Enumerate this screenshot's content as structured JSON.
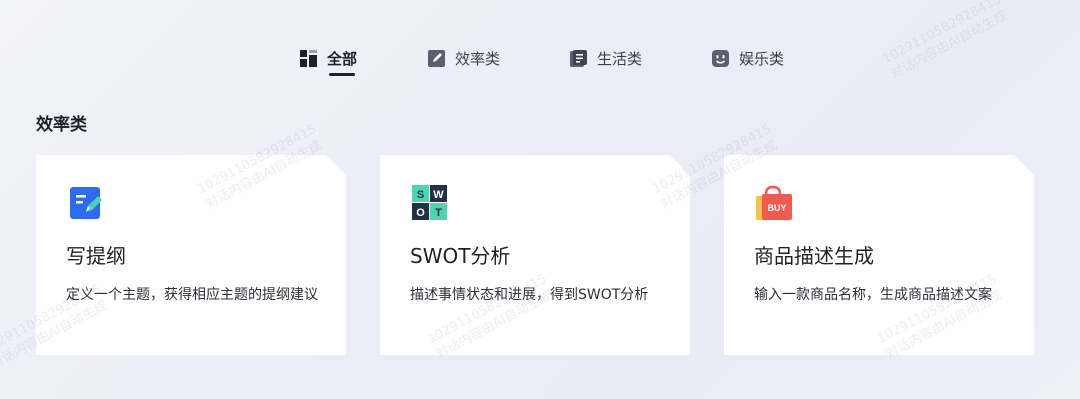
{
  "tabs": [
    {
      "label": "全部",
      "icon": "grid-icon",
      "active": true
    },
    {
      "label": "效率类",
      "icon": "edit-doc-icon",
      "active": false
    },
    {
      "label": "生活类",
      "icon": "notes-icon",
      "active": false
    },
    {
      "label": "娱乐类",
      "icon": "smiley-icon",
      "active": false
    }
  ],
  "section": {
    "title": "效率类"
  },
  "cards": [
    {
      "title": "写提纲",
      "description": "定义一个主题，获得相应主题的提纲建议",
      "icon": "outline-doc-icon"
    },
    {
      "title": "SWOT分析",
      "description": "描述事情状态和进展，得到SWOT分析",
      "icon": "swot-icon",
      "icon_letters": [
        "S",
        "W",
        "O",
        "T"
      ]
    },
    {
      "title": "商品描述生成",
      "description": "输入一款商品名称，生成商品描述文案",
      "icon": "shopping-bag-icon",
      "icon_text": "BUY"
    }
  ],
  "watermark": {
    "id": "102911058292841​5",
    "text": "对话内容由AI自动生成"
  },
  "colors": {
    "accent_blue": "#2f6bf0",
    "swot_dark": "#233146",
    "swot_teal": "#4fd4b0",
    "bag_red": "#f05a4f",
    "bag_yellow": "#f7c24a"
  }
}
